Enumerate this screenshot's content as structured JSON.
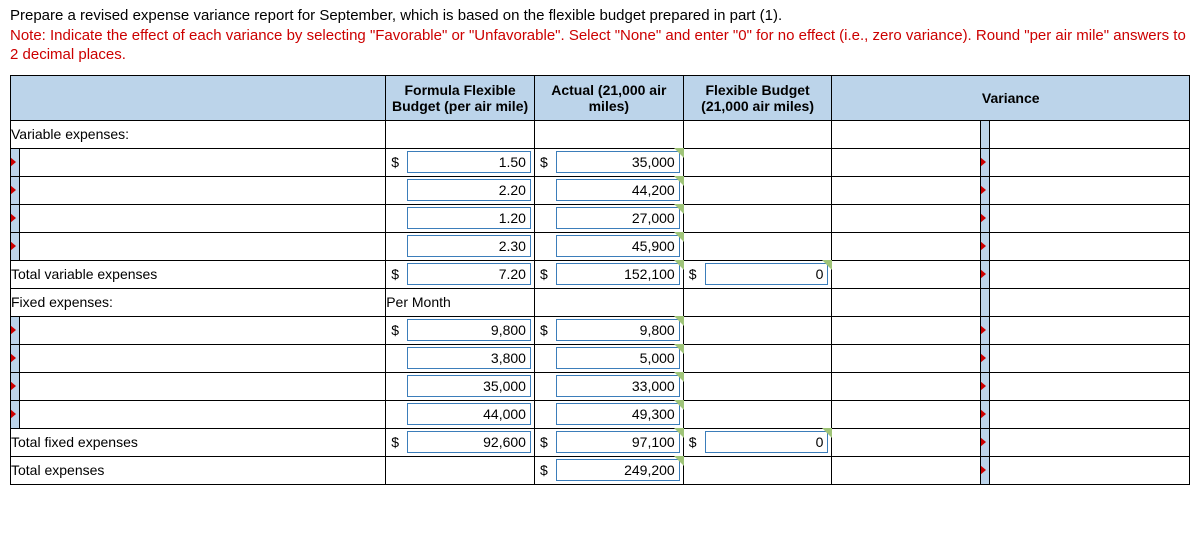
{
  "instructions": {
    "line1": "Prepare a revised expense variance report for September, which is based on the flexible budget prepared in part (1).",
    "note": "Note: Indicate the effect of each variance by selecting \"Favorable\" or \"Unfavorable\". Select \"None\" and enter \"0\" for no effect (i.e., zero variance). Round \"per air mile\" answers to 2 decimal places."
  },
  "headers": {
    "label": "",
    "formula": "Formula Flexible Budget (per air mile)",
    "actual": "Actual (21,000 air miles)",
    "flex": "Flexible Budget (21,000 air miles)",
    "variance": "Variance"
  },
  "sections": {
    "variable": "Variable expenses:",
    "fixed": "Fixed expenses:",
    "per_month": "Per Month"
  },
  "rows": {
    "v1": {
      "formula_cur": "$",
      "formula_val": "1.50",
      "actual_cur": "$",
      "actual_val": "35,000"
    },
    "v2": {
      "formula_val": "2.20",
      "actual_val": "44,200"
    },
    "v3": {
      "formula_val": "1.20",
      "actual_val": "27,000"
    },
    "v4": {
      "formula_val": "2.30",
      "actual_val": "45,900"
    },
    "vt": {
      "label": "Total variable expenses",
      "formula_cur": "$",
      "formula_val": "7.20",
      "actual_cur": "$",
      "actual_val": "152,100",
      "flex_cur": "$",
      "flex_val": "0"
    },
    "f1": {
      "formula_cur": "$",
      "formula_val": "9,800",
      "actual_cur": "$",
      "actual_val": "9,800"
    },
    "f2": {
      "formula_val": "3,800",
      "actual_val": "5,000"
    },
    "f3": {
      "formula_val": "35,000",
      "actual_val": "33,000"
    },
    "f4": {
      "formula_val": "44,000",
      "actual_val": "49,300"
    },
    "ft": {
      "label": "Total fixed expenses",
      "formula_cur": "$",
      "formula_val": "92,600",
      "actual_cur": "$",
      "actual_val": "97,100",
      "flex_cur": "$",
      "flex_val": "0"
    },
    "tt": {
      "label": "Total expenses",
      "actual_cur": "$",
      "actual_val": "249,200"
    }
  }
}
